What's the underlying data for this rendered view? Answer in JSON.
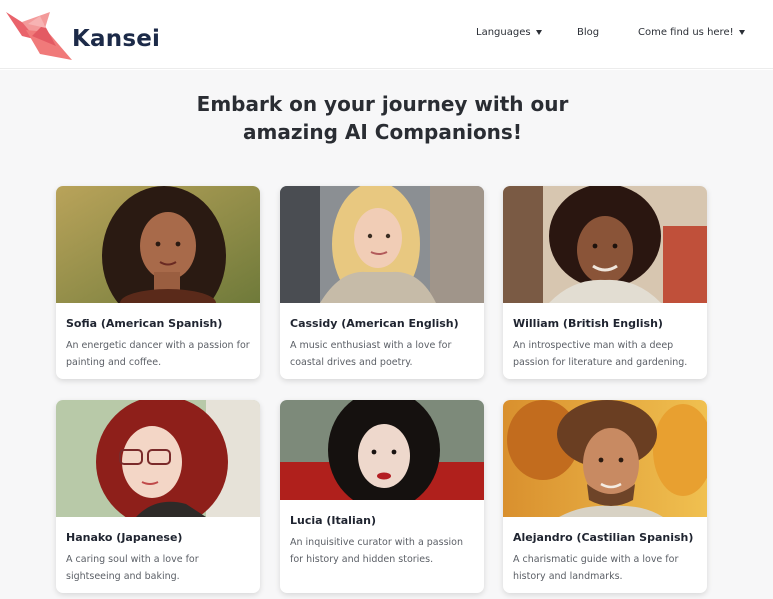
{
  "brand": {
    "name": "Kansei",
    "accent": "#f07a7a",
    "text_color": "#1c2a48"
  },
  "nav": {
    "languages": "Languages",
    "blog": "Blog",
    "find_us": "Come find us here!"
  },
  "headline": {
    "line1": "Embark on your journey with our",
    "line2": "amazing AI Companions!"
  },
  "companions": [
    {
      "name": "Sofia (American Spanish)",
      "description": "An energetic dancer with a passion for painting and coffee."
    },
    {
      "name": "Cassidy (American English)",
      "description": "A music enthusiast with a love for coastal drives and poetry."
    },
    {
      "name": "William (British English)",
      "description": "An introspective man with a deep passion for literature and gardening."
    },
    {
      "name": "Hanako (Japanese)",
      "description": "A caring soul with a love for sightseeing and baking."
    },
    {
      "name": "Lucia (Italian)",
      "description": "An inquisitive curator with a passion for history and hidden stories."
    },
    {
      "name": "Alejandro (Castilian Spanish)",
      "description": "A charismatic guide with a love for history and landmarks."
    }
  ]
}
